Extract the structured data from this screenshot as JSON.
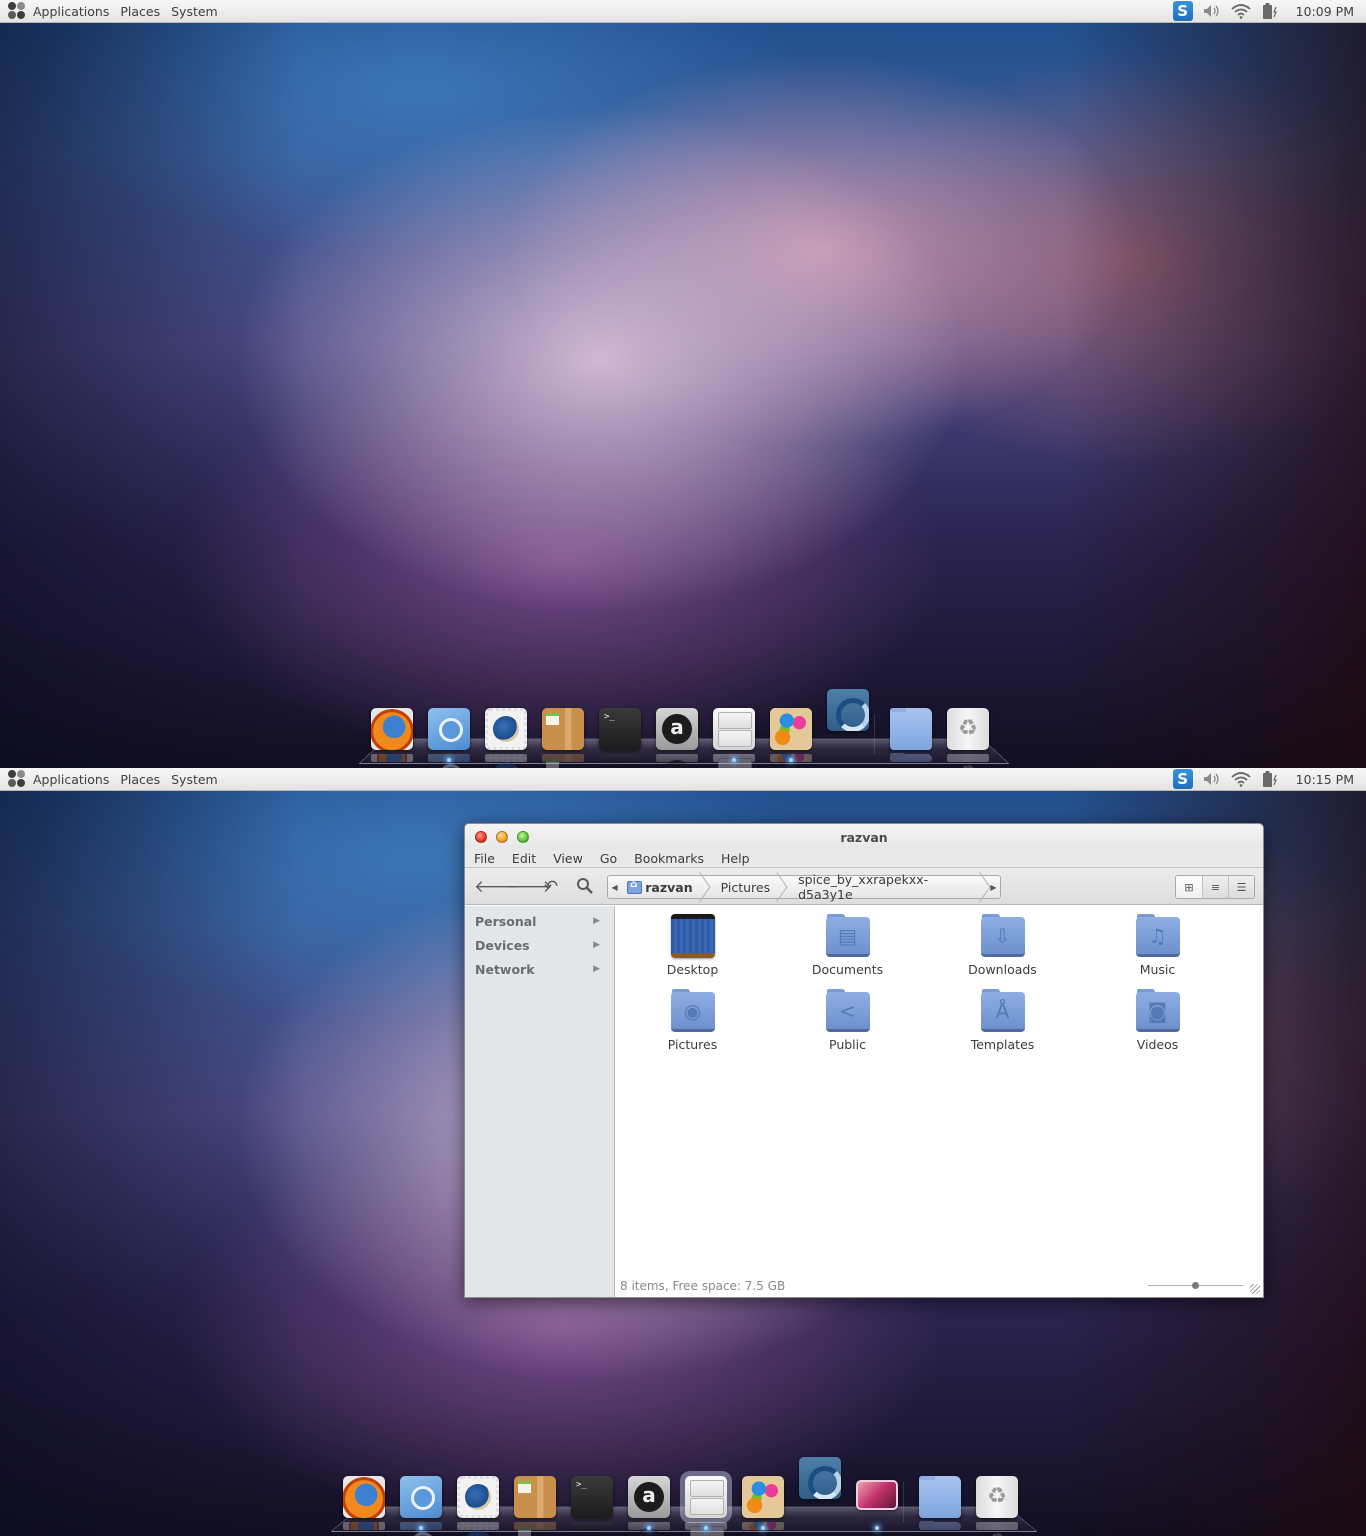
{
  "panel": {
    "menus": [
      "Applications",
      "Places",
      "System"
    ],
    "tray": {
      "app_icon": "spice-up-icon",
      "volume_icon": "volume-icon",
      "wifi_icon": "wifi-icon",
      "battery_icon": "battery-charging-icon"
    }
  },
  "screens": [
    {
      "clock": "10:09 PM",
      "dock": {
        "items": [
          {
            "name": "firefox",
            "icon": "firefox-icon",
            "running": false
          },
          {
            "name": "chromium",
            "icon": "chromium-icon",
            "running": true
          },
          {
            "name": "thunderbird",
            "icon": "thunderbird-icon",
            "running": false
          },
          {
            "name": "package-manager",
            "icon": "package-icon",
            "running": false
          },
          {
            "name": "terminal",
            "icon": "terminal-icon",
            "running": false
          },
          {
            "name": "anjuta",
            "icon": "anjuta-icon",
            "running": false
          },
          {
            "name": "file-manager",
            "icon": "file-cabinet-icon",
            "running": true
          },
          {
            "name": "paint",
            "icon": "paint-splash-icon",
            "running": true
          },
          {
            "name": "spice-up",
            "icon": "spice-icon",
            "running": false,
            "raised": true
          },
          {
            "name": "folder",
            "icon": "folder-icon",
            "running": false
          },
          {
            "name": "trash",
            "icon": "trash-icon",
            "running": false
          }
        ]
      }
    },
    {
      "clock": "10:15 PM",
      "dock": {
        "items": [
          {
            "name": "firefox",
            "icon": "firefox-icon",
            "running": false
          },
          {
            "name": "chromium",
            "icon": "chromium-icon",
            "running": true
          },
          {
            "name": "thunderbird",
            "icon": "thunderbird-icon",
            "running": false
          },
          {
            "name": "package-manager",
            "icon": "package-icon",
            "running": false
          },
          {
            "name": "terminal",
            "icon": "terminal-icon",
            "running": false
          },
          {
            "name": "anjuta",
            "icon": "anjuta-icon",
            "running": true
          },
          {
            "name": "file-manager",
            "icon": "file-cabinet-icon",
            "running": true,
            "active": true
          },
          {
            "name": "paint",
            "icon": "paint-splash-icon",
            "running": true
          },
          {
            "name": "spice-up",
            "icon": "spice-icon",
            "running": false,
            "raised": true
          },
          {
            "name": "image-viewer",
            "icon": "image-viewer-icon",
            "running": true
          },
          {
            "name": "folder",
            "icon": "folder-icon",
            "running": false
          },
          {
            "name": "trash",
            "icon": "trash-icon",
            "running": false
          }
        ]
      }
    }
  ],
  "file_manager": {
    "title": "razvan",
    "menus": [
      "File",
      "Edit",
      "View",
      "Go",
      "Bookmarks",
      "Help"
    ],
    "path": [
      "razvan",
      "Pictures",
      "spice_by_xxrapekxx-d5a3y1e"
    ],
    "active_crumb": "razvan",
    "view_modes": [
      "icon-view",
      "list-view",
      "compact-view"
    ],
    "active_view": "icon-view",
    "sidebar": [
      {
        "label": "Personal"
      },
      {
        "label": "Devices"
      },
      {
        "label": "Network"
      }
    ],
    "items": [
      {
        "label": "Desktop",
        "glyph": ""
      },
      {
        "label": "Documents",
        "glyph": "▤"
      },
      {
        "label": "Downloads",
        "glyph": "⇩"
      },
      {
        "label": "Music",
        "glyph": "♫"
      },
      {
        "label": "Pictures",
        "glyph": "◉"
      },
      {
        "label": "Public",
        "glyph": "<"
      },
      {
        "label": "Templates",
        "glyph": "Å"
      },
      {
        "label": "Videos",
        "glyph": "◙"
      }
    ],
    "status": "8 items, Free space: 7.5 GB",
    "zoom_level": 0.5
  },
  "colors": {
    "panel_bg": "#eeeeee",
    "folder_blue": "#7fa5de",
    "sidebar_bg": "#e3e7ea"
  }
}
